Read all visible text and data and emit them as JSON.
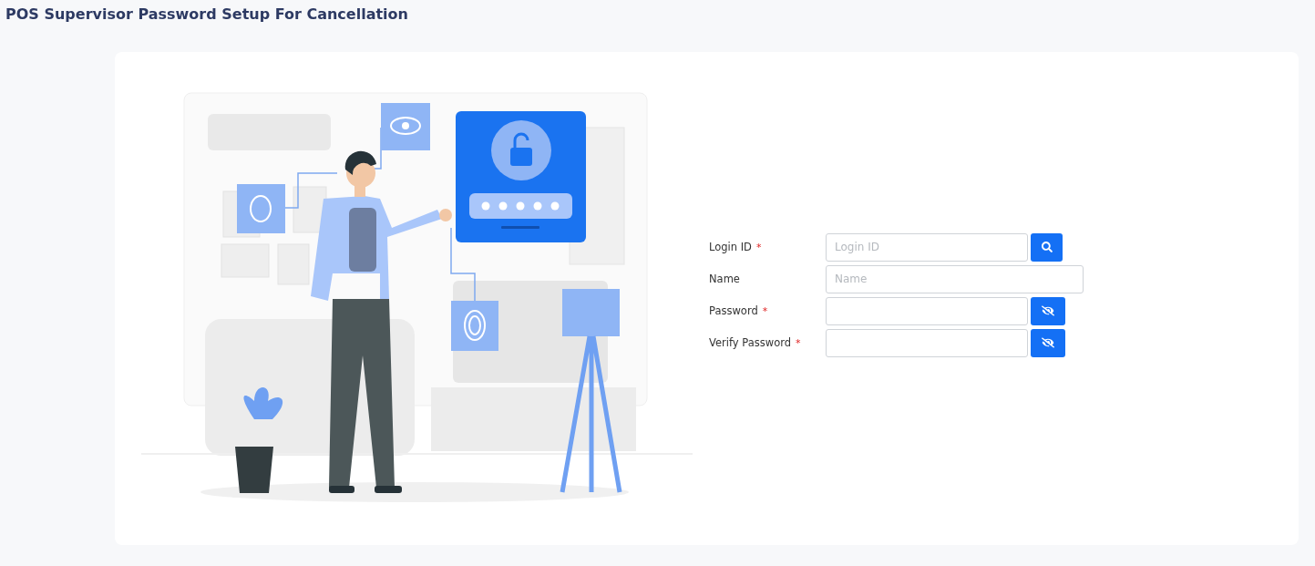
{
  "page": {
    "title": "POS Supervisor Password Setup For Cancellation"
  },
  "form": {
    "fields": [
      {
        "kind": "search",
        "label": "Login ID",
        "required_mark": "*",
        "placeholder": "Login ID"
      },
      {
        "kind": "plain",
        "label": "Name",
        "placeholder": "Name"
      },
      {
        "kind": "password",
        "label": "Password",
        "required_mark": "*"
      },
      {
        "kind": "password",
        "label": "Verify Password",
        "required_mark": "*"
      }
    ]
  }
}
